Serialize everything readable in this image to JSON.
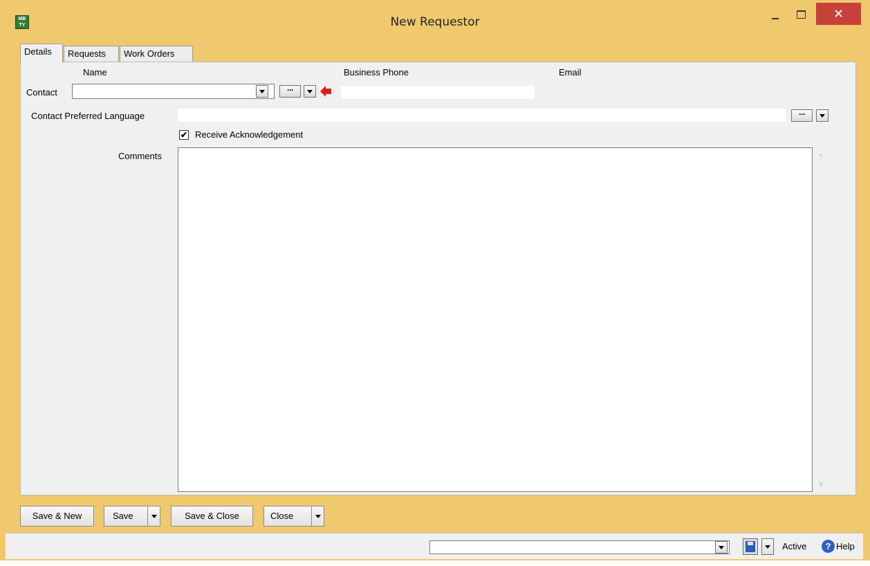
{
  "window": {
    "title": "New Requestor",
    "app_icon_text": "MB\nTY",
    "close_glyph": "✕"
  },
  "tabs": [
    {
      "label": "Details",
      "active": true
    },
    {
      "label": "Requests",
      "active": false
    },
    {
      "label": "Work Orders",
      "active": false
    }
  ],
  "details": {
    "header_name": "Name",
    "header_phone": "Business Phone",
    "header_email": "Email",
    "contact_label": "Contact",
    "contact_value": "",
    "business_phone_value": "",
    "email_value": "",
    "dots_glyph": "···",
    "preferred_language_label": "Contact Preferred Language",
    "preferred_language_value": "",
    "receive_ack_label": "Receive Acknowledgement",
    "receive_ack_checked": true,
    "check_glyph": "✔",
    "comments_label": "Comments",
    "comments_value": "",
    "scroll_up_glyph": "^",
    "scroll_down_glyph": "v"
  },
  "buttons": {
    "save_new": "Save & New",
    "save": "Save",
    "save_close": "Save & Close",
    "close": "Close"
  },
  "statusbar": {
    "record_value": "",
    "status": "Active",
    "help_icon_glyph": "?",
    "help_label": "Help"
  },
  "colors": {
    "title_bar": "#f0c86e",
    "close_button": "#c7413a",
    "arrow": "#e01e1e"
  },
  "icons": [
    "app-logo-icon",
    "minimize-icon",
    "maximize-icon",
    "close-icon",
    "dropdown-arrow-icon",
    "lookup-ellipsis-icon",
    "red-left-arrow-icon",
    "checkmark-icon",
    "save-floppy-icon",
    "help-icon"
  ]
}
